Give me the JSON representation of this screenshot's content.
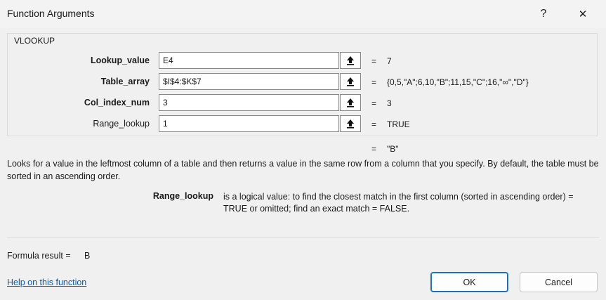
{
  "window": {
    "title": "Function Arguments",
    "help_glyph": "?",
    "close_glyph": "✕"
  },
  "function_group": {
    "name": "VLOOKUP",
    "args": [
      {
        "label": "Lookup_value",
        "value": "E4",
        "equals": "=",
        "result": "7"
      },
      {
        "label": "Table_array",
        "value": "$I$4:$K$7",
        "equals": "=",
        "result": "{0,5,\"A\";6,10,\"B\";11,15,\"C\";16,\"∞\",\"D\"}"
      },
      {
        "label": "Col_index_num",
        "value": "3",
        "equals": "=",
        "result": "3"
      },
      {
        "label": "Range_lookup",
        "value": "1",
        "equals": "=",
        "result": "TRUE"
      }
    ]
  },
  "overall": {
    "equals": "=",
    "result": "\"B\""
  },
  "description": "Looks for a value in the leftmost column of a table and then returns a value in the same row from a column that you specify. By default, the table must be sorted in an ascending order.",
  "param_help": {
    "name": "Range_lookup",
    "text": "is a logical value: to find the closest match in the first column (sorted in ascending order) = TRUE or omitted; find an exact match = FALSE."
  },
  "formula_result": {
    "label": "Formula result =",
    "value": "B"
  },
  "help_link": "Help on this function",
  "buttons": {
    "ok": "OK",
    "cancel": "Cancel"
  },
  "colors": {
    "link": "#0b5cad",
    "ok_border": "#1f6fbf",
    "background": "#f0f0f0"
  }
}
